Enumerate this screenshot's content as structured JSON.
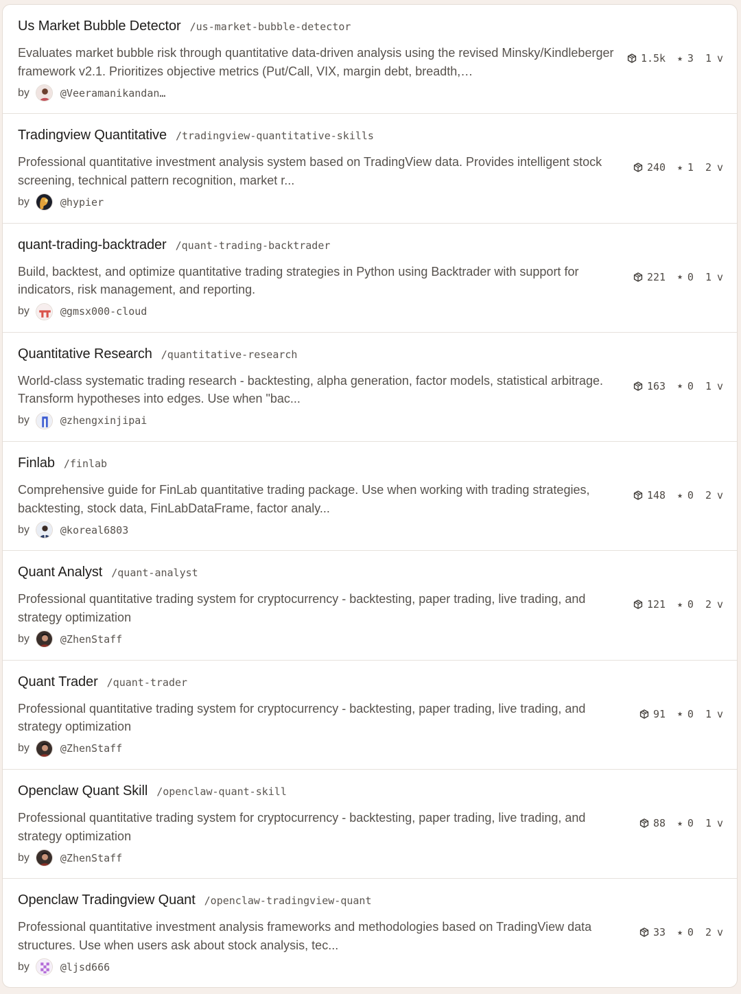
{
  "colors": {
    "page_background": "#f6efea",
    "card_background": "#ffffff",
    "title_text": "#1f1d1b",
    "body_text": "#57524d",
    "divider": "#e6e1dc"
  },
  "labels": {
    "by": "by",
    "star_icon": "★",
    "version_suffix": "v"
  },
  "skills": [
    {
      "title": "Us Market Bubble Detector",
      "slug": "/us-market-bubble-detector",
      "description": "Evaluates market bubble risk through quantitative data-driven analysis using the revised Minsky/Kindleberger framework v2.1. Prioritizes objective metrics (Put/Call, VIX, margin debt, breadth,…",
      "author": "@Veeramanikandan…",
      "avatar": "person-photo",
      "downloads": "1.5k",
      "stars": "3",
      "versions": "1"
    },
    {
      "title": "Tradingview Quantitative",
      "slug": "/tradingview-quantitative-skills",
      "description": "Professional quantitative investment analysis system based on TradingView data. Provides intelligent stock screening, technical pattern recognition, market r...",
      "author": "@hypier",
      "avatar": "dark-artwork",
      "downloads": "240",
      "stars": "1",
      "versions": "2"
    },
    {
      "title": "quant-trading-backtrader",
      "slug": "/quant-trading-backtrader",
      "description": "Build, backtest, and optimize quantitative trading strategies in Python using Backtrader with support for indicators, risk management, and reporting.",
      "author": "@gmsx000-cloud",
      "avatar": "red-logo",
      "downloads": "221",
      "stars": "0",
      "versions": "1"
    },
    {
      "title": "Quantitative Research",
      "slug": "/quantitative-research",
      "description": "World-class systematic trading research - backtesting, alpha generation, factor models, statistical arbitrage. Transform hypotheses into edges. Use when \"bac...",
      "author": "@zhengxinjipai",
      "avatar": "blue-logo",
      "downloads": "163",
      "stars": "0",
      "versions": "1"
    },
    {
      "title": "Finlab",
      "slug": "/finlab",
      "description": "Comprehensive guide for FinLab quantitative trading package. Use when working with trading strategies, backtesting, stock data, FinLabDataFrame, factor analy...",
      "author": "@koreal6803",
      "avatar": "person-suit",
      "downloads": "148",
      "stars": "0",
      "versions": "2"
    },
    {
      "title": "Quant Analyst",
      "slug": "/quant-analyst",
      "description": "Professional quantitative trading system for cryptocurrency - backtesting, paper trading, live trading, and strategy optimization",
      "author": "@ZhenStaff",
      "avatar": "person-dark",
      "downloads": "121",
      "stars": "0",
      "versions": "2"
    },
    {
      "title": "Quant Trader",
      "slug": "/quant-trader",
      "description": "Professional quantitative trading system for cryptocurrency - backtesting, paper trading, live trading, and strategy optimization",
      "author": "@ZhenStaff",
      "avatar": "person-dark",
      "downloads": "91",
      "stars": "0",
      "versions": "1"
    },
    {
      "title": "Openclaw Quant Skill",
      "slug": "/openclaw-quant-skill",
      "description": "Professional quantitative trading system for cryptocurrency - backtesting, paper trading, live trading, and strategy optimization",
      "author": "@ZhenStaff",
      "avatar": "person-dark",
      "downloads": "88",
      "stars": "0",
      "versions": "1"
    },
    {
      "title": "Openclaw Tradingview Quant",
      "slug": "/openclaw-tradingview-quant",
      "description": "Professional quantitative investment analysis frameworks and methodologies based on TradingView data structures. Use when users ask about stock analysis, tec...",
      "author": "@ljsd666",
      "avatar": "pixel-identicon",
      "downloads": "33",
      "stars": "0",
      "versions": "2"
    }
  ]
}
